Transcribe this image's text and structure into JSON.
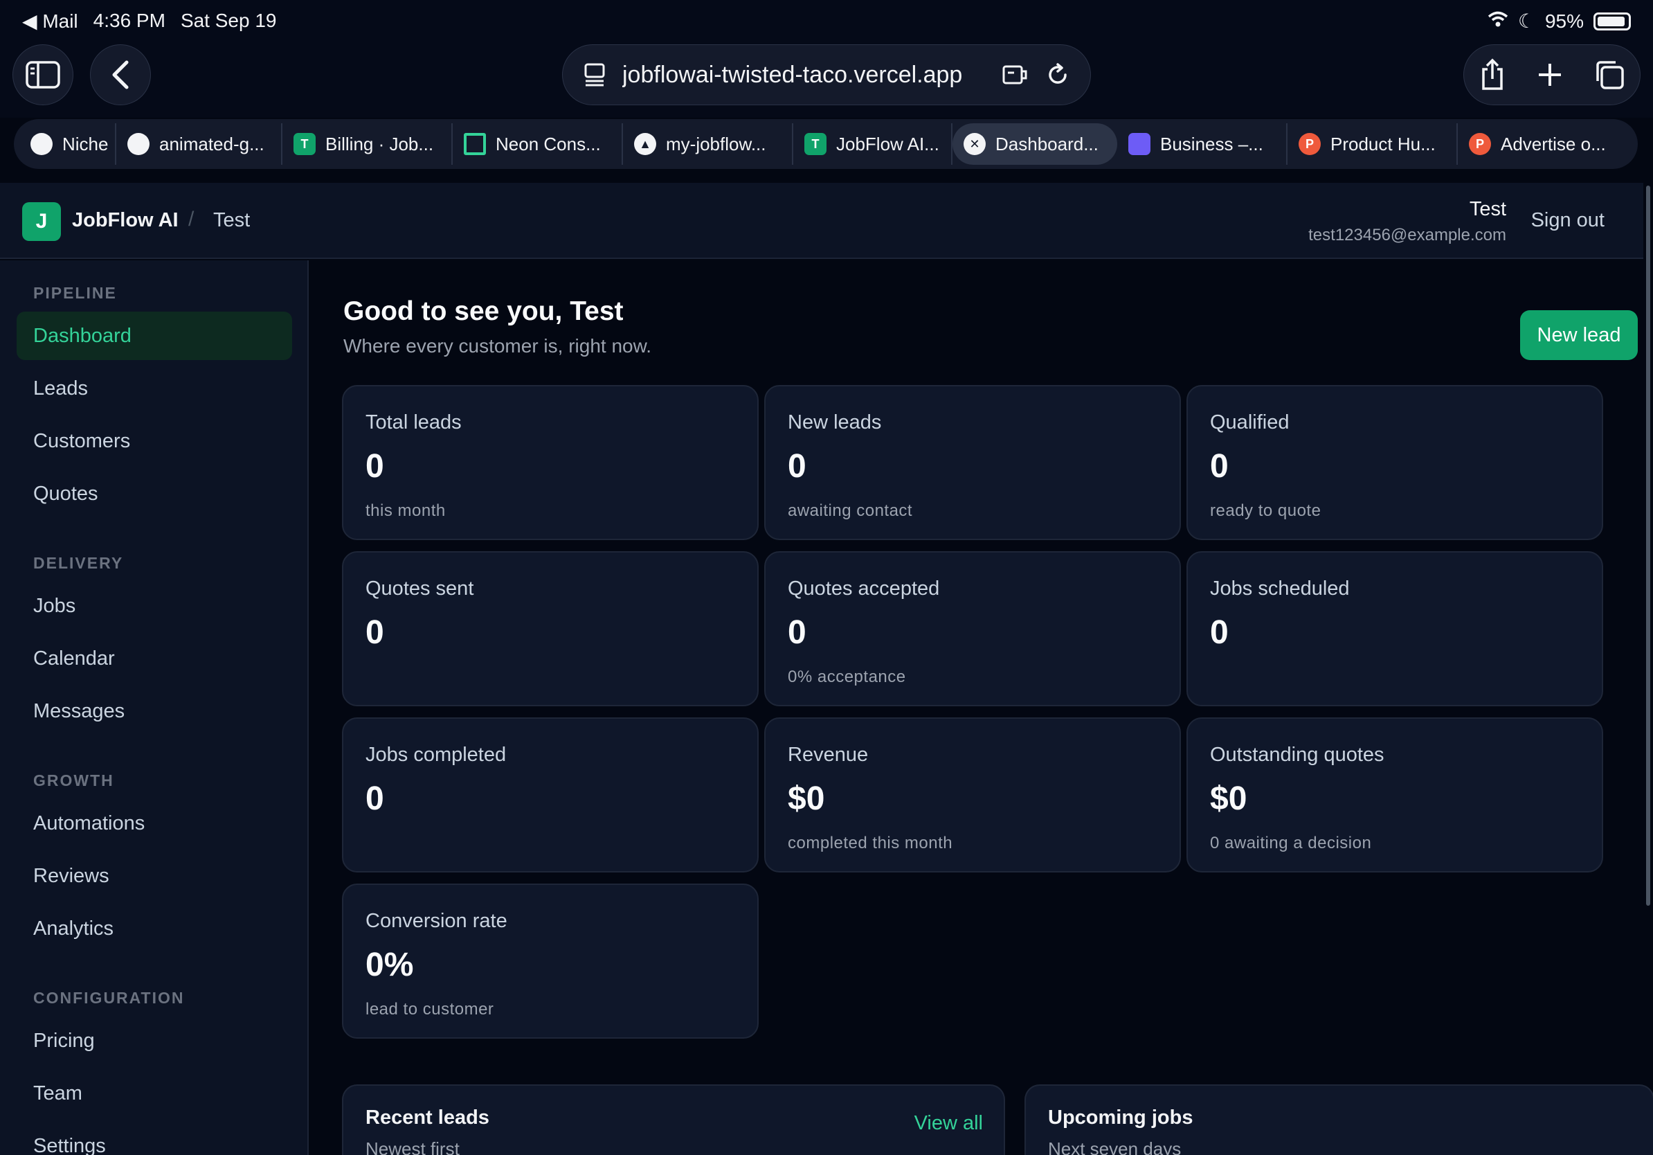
{
  "status_bar": {
    "back_app": "◀ Mail",
    "time": "4:36 PM",
    "date": "Sat Sep 19",
    "battery": "95%"
  },
  "browser": {
    "url": "jobflowai-twisted-taco.vercel.app",
    "tabs": [
      {
        "label": "Niche",
        "icon": "github-icon",
        "color": "#f3f4f6",
        "glyph": ""
      },
      {
        "label": "animated-g...",
        "icon": "github-icon",
        "color": "#f3f4f6",
        "glyph": ""
      },
      {
        "label": "Billing · Job...",
        "icon": "t-icon",
        "color": "#10a36a",
        "glyph": "T"
      },
      {
        "label": "Neon Cons...",
        "icon": "neon-icon",
        "color": "#34d399",
        "glyph": ""
      },
      {
        "label": "my-jobflow...",
        "icon": "vercel-icon",
        "color": "#f3f4f6",
        "glyph": ""
      },
      {
        "label": "JobFlow AI...",
        "icon": "t-icon",
        "color": "#10a36a",
        "glyph": "T"
      },
      {
        "label": "Dashboard...",
        "icon": "close-icon",
        "color": "#f3f4f6",
        "glyph": "✕",
        "active": true
      },
      {
        "label": "Business –...",
        "icon": "chat-icon",
        "color": "#6d5cf6",
        "glyph": ""
      },
      {
        "label": "Product Hu...",
        "icon": "producthunt-icon",
        "color": "#ef5a3c",
        "glyph": "P"
      },
      {
        "label": "Advertise o...",
        "icon": "producthunt-icon",
        "color": "#ef5a3c",
        "glyph": "P"
      }
    ]
  },
  "header": {
    "logo_letter": "J",
    "brand": "JobFlow AI",
    "separator": "/",
    "breadcrumb": "Test",
    "user_name": "Test",
    "user_email": "test123456@example.com",
    "sign_out": "Sign out"
  },
  "sidebar": {
    "sections": [
      {
        "label": "PIPELINE",
        "items": [
          "Dashboard",
          "Leads",
          "Customers",
          "Quotes"
        ]
      },
      {
        "label": "DELIVERY",
        "items": [
          "Jobs",
          "Calendar",
          "Messages"
        ]
      },
      {
        "label": "GROWTH",
        "items": [
          "Automations",
          "Reviews",
          "Analytics"
        ]
      },
      {
        "label": "CONFIGURATION",
        "items": [
          "Pricing",
          "Team",
          "Settings"
        ]
      }
    ],
    "active_item": "Dashboard"
  },
  "main": {
    "greeting": "Good to see you, Test",
    "subtitle": "Where every customer is, right now.",
    "new_lead_button": "New lead",
    "stats": [
      {
        "label": "Total leads",
        "value": "0",
        "sub": "this month"
      },
      {
        "label": "New leads",
        "value": "0",
        "sub": "awaiting contact"
      },
      {
        "label": "Qualified",
        "value": "0",
        "sub": "ready to quote"
      },
      {
        "label": "Quotes sent",
        "value": "0",
        "sub": ""
      },
      {
        "label": "Quotes accepted",
        "value": "0",
        "sub": "0% acceptance"
      },
      {
        "label": "Jobs scheduled",
        "value": "0",
        "sub": ""
      },
      {
        "label": "Jobs completed",
        "value": "0",
        "sub": ""
      },
      {
        "label": "Revenue",
        "value": "$0",
        "sub": "completed this month"
      },
      {
        "label": "Outstanding quotes",
        "value": "$0",
        "sub": "0 awaiting a decision"
      },
      {
        "label": "Conversion rate",
        "value": "0%",
        "sub": "lead to customer"
      }
    ],
    "recent_leads": {
      "title": "Recent leads",
      "subtitle": "Newest first",
      "link": "View all"
    },
    "upcoming_jobs": {
      "title": "Upcoming jobs",
      "subtitle": "Next seven days"
    }
  },
  "colors": {
    "accent": "#10a36a",
    "accent_text": "#34d399",
    "background": "#030712",
    "card": "#0f172a"
  }
}
